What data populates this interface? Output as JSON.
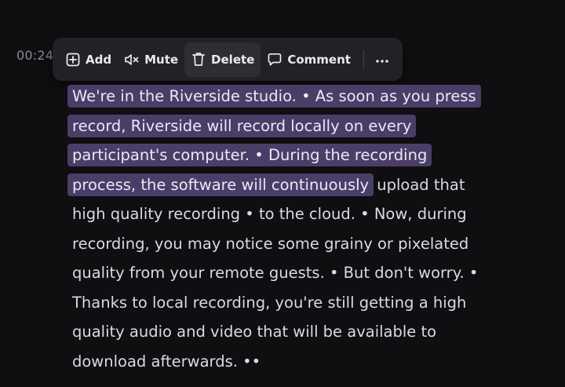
{
  "timestamp": "00:24",
  "toolbar": {
    "add_label": "Add",
    "mute_label": "Mute",
    "delete_label": "Delete",
    "comment_label": "Comment",
    "add_icon": "plus-square-icon",
    "mute_icon": "speaker-mute-icon",
    "delete_icon": "trash-icon",
    "comment_icon": "speech-bubble-icon",
    "more_icon": "ellipsis-icon"
  },
  "transcript": {
    "lines": [
      {
        "highlighted": "We're in the Riverside studio. • As soon as you press",
        "rest": ""
      },
      {
        "highlighted": "record, Riverside will record locally on every",
        "rest": ""
      },
      {
        "highlighted": "participant's computer. • During the recording",
        "rest": ""
      },
      {
        "highlighted": "process, the software will continuously",
        "rest": " upload that"
      },
      {
        "highlighted": "",
        "rest": "high quality recording • to the cloud. • Now, during"
      },
      {
        "highlighted": "",
        "rest": "recording, you may notice some grainy or pixelated"
      },
      {
        "highlighted": "",
        "rest": "quality from your remote guests. • But don't worry. •"
      },
      {
        "highlighted": "",
        "rest": "Thanks to local recording, you're still getting a high"
      },
      {
        "highlighted": "",
        "rest": "quality audio and video that will be available to"
      },
      {
        "highlighted": "",
        "rest": "download afterwards. ••"
      }
    ]
  },
  "colors": {
    "background": "#0f0e10",
    "toolbar": "#222125",
    "highlight": "#4a3e68",
    "text": "#dcdae0"
  }
}
